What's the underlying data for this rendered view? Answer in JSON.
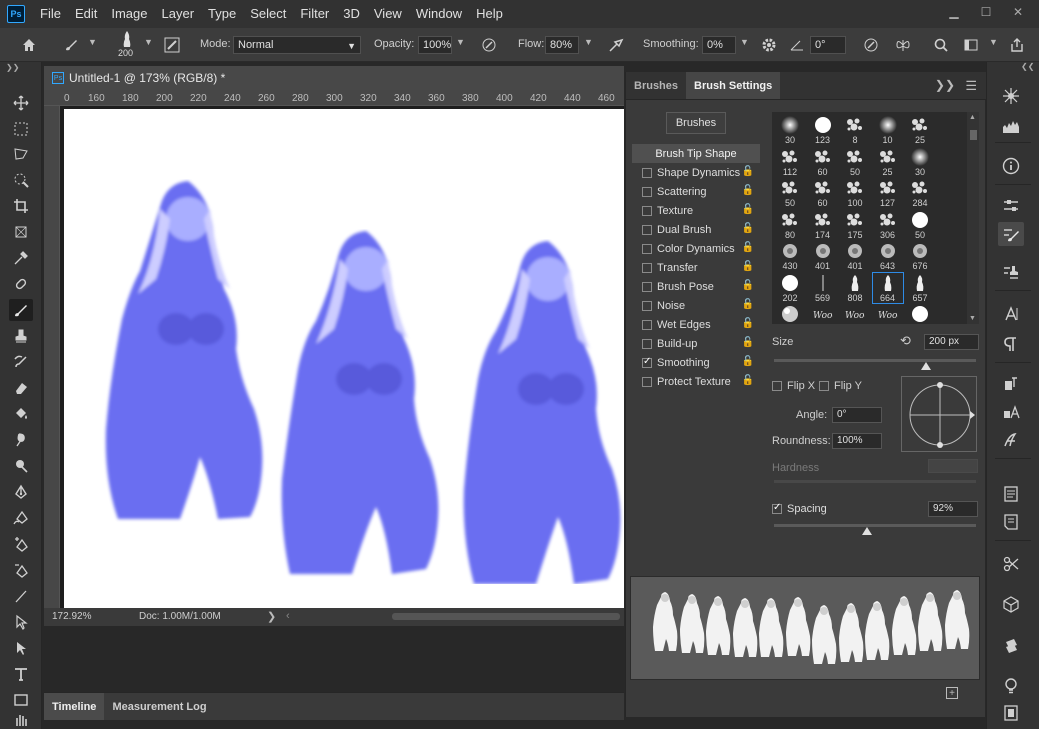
{
  "app": {
    "logo": "Ps"
  },
  "menu": [
    "File",
    "Edit",
    "Image",
    "Layer",
    "Type",
    "Select",
    "Filter",
    "3D",
    "View",
    "Window",
    "Help"
  ],
  "window_controls": {
    "minimize": "▁",
    "maximize": "☐",
    "close": "✕"
  },
  "options": {
    "brush_size": "200",
    "mode_label": "Mode:",
    "mode_value": "Normal",
    "opacity_label": "Opacity:",
    "opacity_value": "100%",
    "flow_label": "Flow:",
    "flow_value": "80%",
    "smoothing_label": "Smoothing:",
    "smoothing_value": "0%",
    "angle_value": "0°"
  },
  "document": {
    "tab_icon": "Ps",
    "title": "Untitled-1 @ 173% (RGB/8) *",
    "ruler_ticks": [
      "0",
      "160",
      "180",
      "200",
      "220",
      "240",
      "260",
      "280",
      "300",
      "320",
      "340",
      "360",
      "380",
      "400",
      "420",
      "440",
      "460"
    ],
    "zoom": "172.92%",
    "doc_info": "Doc: 1.00M/1.00M",
    "status_arrow": "❯",
    "status_left": "‹"
  },
  "bottom_tabs": [
    "Timeline",
    "Measurement Log"
  ],
  "panel": {
    "tabs": [
      "Brushes",
      "Brush Settings"
    ],
    "collapse_icon": "❯❯",
    "menu_icon": "☰",
    "brushes_button": "Brushes",
    "settings_header": "Brush Tip Shape",
    "settings": [
      {
        "label": "Shape Dynamics",
        "checked": false
      },
      {
        "label": "Scattering",
        "checked": false
      },
      {
        "label": "Texture",
        "checked": false
      },
      {
        "label": "Dual Brush",
        "checked": false
      },
      {
        "label": "Color Dynamics",
        "checked": false
      },
      {
        "label": "Transfer",
        "checked": false
      },
      {
        "label": "Brush Pose",
        "checked": false
      },
      {
        "label": "Noise",
        "checked": false
      },
      {
        "label": "Wet Edges",
        "checked": false
      },
      {
        "label": "Build-up",
        "checked": false
      },
      {
        "label": "Smoothing",
        "checked": true
      },
      {
        "label": "Protect Texture",
        "checked": false
      }
    ],
    "tips": [
      [
        "30",
        "123",
        "8",
        "10",
        "25"
      ],
      [
        "112",
        "60",
        "50",
        "25",
        "30"
      ],
      [
        "50",
        "60",
        "100",
        "127",
        "284"
      ],
      [
        "80",
        "174",
        "175",
        "306",
        "50"
      ],
      [
        "430",
        "401",
        "401",
        "643",
        "676"
      ],
      [
        "202",
        "569",
        "808",
        "664",
        "657"
      ],
      [
        "",
        "",
        "",
        "",
        ""
      ]
    ],
    "selected_tip": "664",
    "size_label": "Size",
    "size_value": "200 px",
    "size_fraction": 0.75,
    "flip_x": "Flip X",
    "flip_y": "Flip Y",
    "angle_label": "Angle:",
    "angle_value": "0°",
    "roundness_label": "Roundness:",
    "roundness_value": "100%",
    "hardness_label": "Hardness",
    "spacing_label": "Spacing",
    "spacing_checked": true,
    "spacing_value": "92%",
    "spacing_fraction": 0.46,
    "new_preset_icon": "+"
  },
  "colors": {
    "figure": "#5a5ff0",
    "accent": "#2e8be6",
    "panel_bg": "#3a3a3a"
  }
}
